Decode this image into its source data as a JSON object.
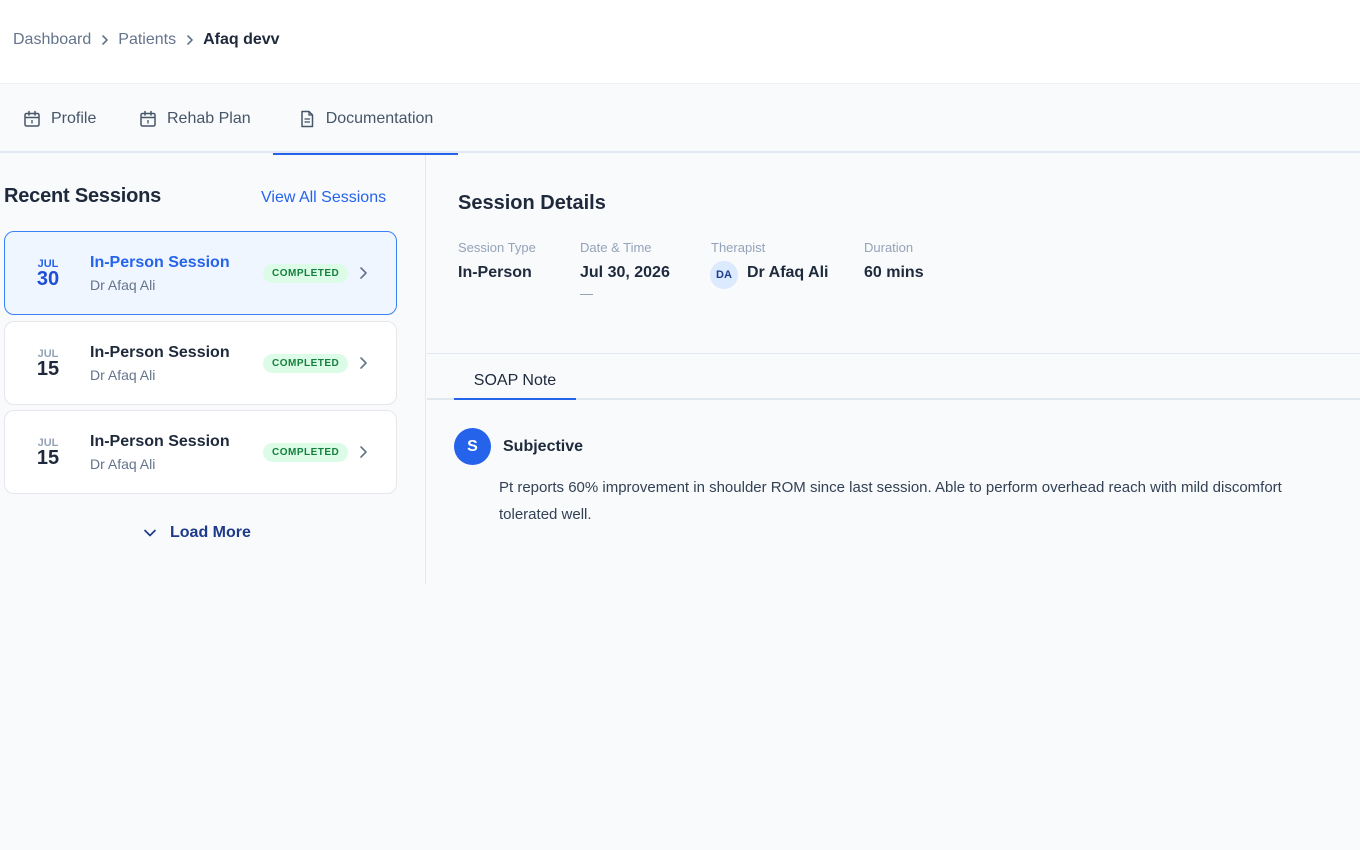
{
  "breadcrumb": {
    "items": [
      "Dashboard",
      "Patients"
    ],
    "current": "Afaq devv"
  },
  "tabs": [
    {
      "label": "Profile",
      "icon": "calendar-icon"
    },
    {
      "label": "Rehab Plan",
      "icon": "calendar-icon"
    },
    {
      "label": "Documentation",
      "icon": "document-icon",
      "active": true
    }
  ],
  "recent_sessions": {
    "title": "Recent Sessions",
    "view_all_label": "View All Sessions",
    "load_more_label": "Load More",
    "sessions": [
      {
        "month": "JUL",
        "day": "30",
        "title": "In-Person Session",
        "therapist": "Dr Afaq Ali",
        "status": "COMPLETED",
        "selected": true
      },
      {
        "month": "JUL",
        "day": "15",
        "title": "In-Person Session",
        "therapist": "Dr Afaq Ali",
        "status": "COMPLETED",
        "selected": false
      },
      {
        "month": "JUL",
        "day": "15",
        "title": "In-Person Session",
        "therapist": "Dr Afaq Ali",
        "status": "COMPLETED",
        "selected": false
      }
    ]
  },
  "session_details": {
    "title": "Session Details",
    "session_type_label": "Session Type",
    "session_type": "In-Person",
    "date_time_label": "Date & Time",
    "date_time": "Jul 30, 2026",
    "therapist_label": "Therapist",
    "therapist_initials": "DA",
    "therapist": "Dr Afaq Ali",
    "duration_label": "Duration",
    "duration": "60 mins"
  },
  "soap": {
    "tab_label": "SOAP Note",
    "subjective": {
      "badge": "S",
      "title": "Subjective",
      "line1": "Pt reports 60% improvement in shoulder ROM since last session. Able to perform overhead reach with mild discomfort",
      "line2": "tolerated well."
    }
  },
  "colors": {
    "accent": "#2563eb",
    "completed_bg": "#dcfce7",
    "completed_text": "#15803d",
    "selected_card_bg": "#eff6ff"
  }
}
